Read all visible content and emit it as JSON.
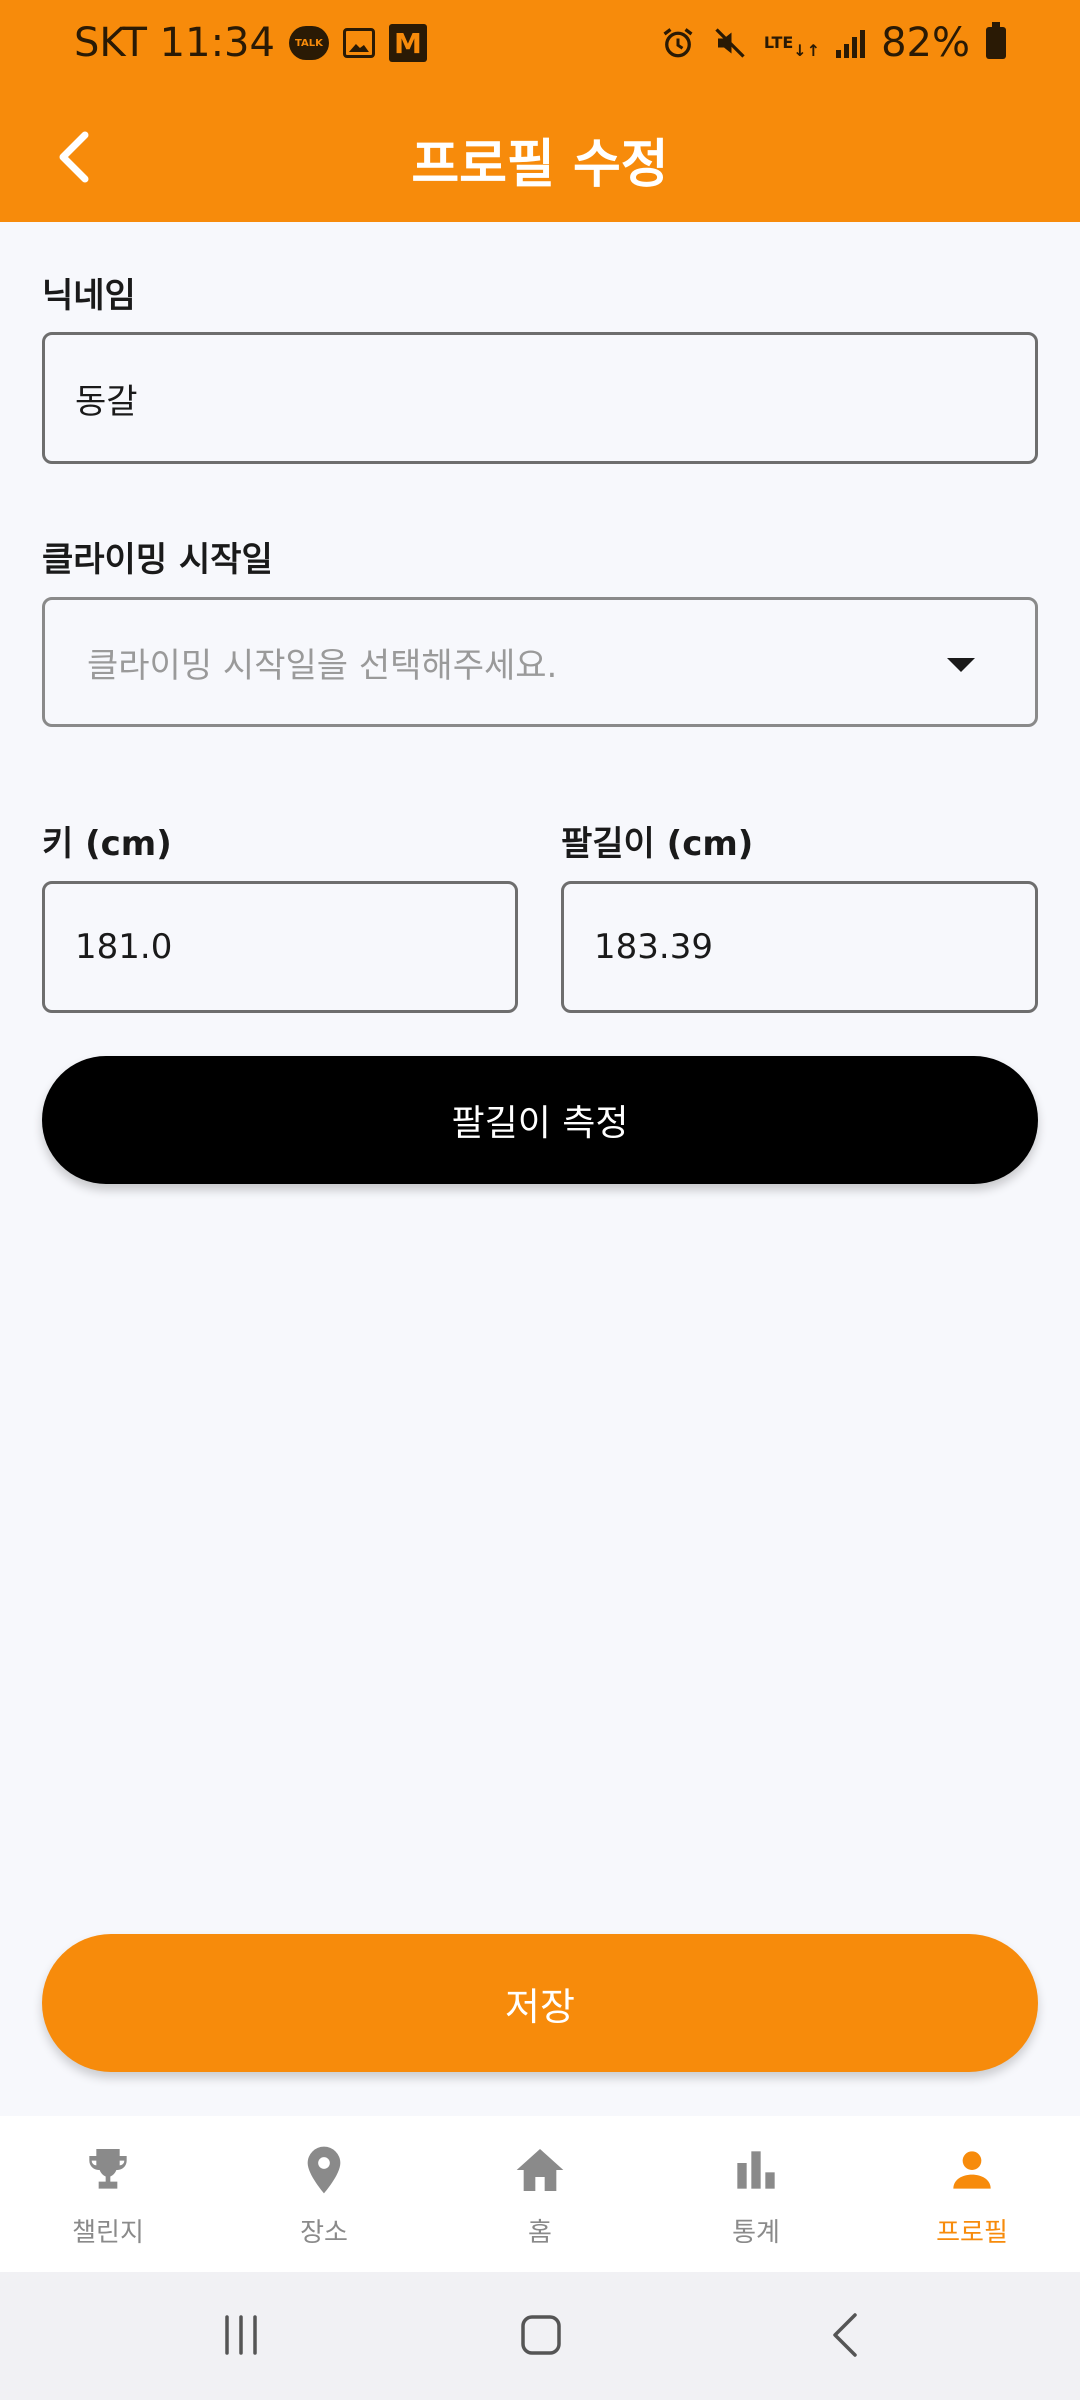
{
  "status_bar": {
    "carrier_time": "SKT 11:34",
    "talk_badge": "TALK",
    "mail_letter": "M",
    "lte_label": "LTE",
    "battery": "82%"
  },
  "app_bar": {
    "title": "프로필 수정"
  },
  "form": {
    "nickname": {
      "label": "닉네임",
      "value": "동갈"
    },
    "start_date": {
      "label": "클라이밍 시작일",
      "placeholder": "클라이밍 시작일을 선택해주세요."
    },
    "height": {
      "label": "키 (cm)",
      "value": "181.0"
    },
    "arm_span": {
      "label": "팔길이 (cm)",
      "value": "183.39"
    },
    "measure_button": "팔길이 측정",
    "save_button": "저장"
  },
  "bottom_nav": {
    "items": [
      {
        "label": "챌린지",
        "icon": "trophy-icon"
      },
      {
        "label": "장소",
        "icon": "location-pin-icon"
      },
      {
        "label": "홈",
        "icon": "home-icon"
      },
      {
        "label": "통계",
        "icon": "bar-chart-icon"
      },
      {
        "label": "프로필",
        "icon": "person-icon"
      }
    ],
    "active_index": 4
  },
  "colors": {
    "accent": "#f78b0b",
    "text": "#1a1a1a",
    "inactive": "#8a8a8a",
    "background": "#f7f8fc"
  }
}
